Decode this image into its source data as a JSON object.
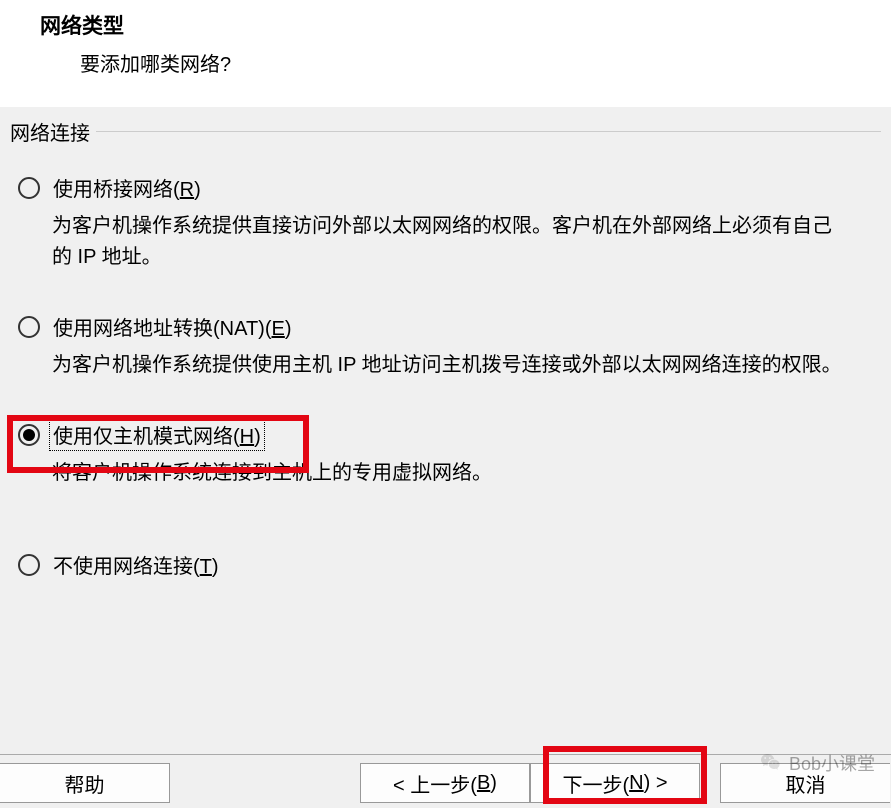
{
  "header": {
    "title": "网络类型",
    "subtitle": "要添加哪类网络?"
  },
  "group_label": "网络连接",
  "options": {
    "bridge": {
      "label_pre": "使用桥接网络(",
      "hotkey": "R",
      "label_post": ")",
      "desc": "为客户机操作系统提供直接访问外部以太网网络的权限。客户机在外部网络上必须有自己的 IP 地址。"
    },
    "nat": {
      "label_pre": "使用网络地址转换(NAT)(",
      "hotkey": "E",
      "label_post": ")",
      "desc": "为客户机操作系统提供使用主机 IP 地址访问主机拨号连接或外部以太网网络连接的权限。"
    },
    "hostonly": {
      "label_pre": "使用仅主机模式网络(",
      "hotkey": "H",
      "label_post": ")",
      "desc": "将客户机操作系统连接到主机上的专用虚拟网络。"
    },
    "none": {
      "label_pre": "不使用网络连接(",
      "hotkey": "T",
      "label_post": ")"
    }
  },
  "buttons": {
    "help": "帮助",
    "back": "< 上一步(",
    "back_hotkey": "B",
    "back_post": ")",
    "next": "下一步(",
    "next_hotkey": "N",
    "next_post": ") >",
    "cancel": "取消"
  },
  "watermark": "Bob小课堂"
}
